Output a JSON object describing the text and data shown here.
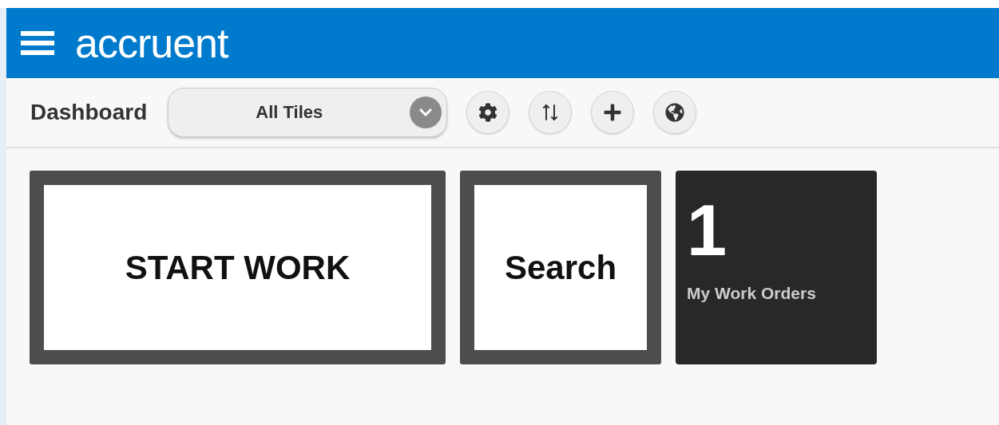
{
  "header": {
    "logo": "accruent"
  },
  "toolbar": {
    "title": "Dashboard",
    "tile_filter": {
      "value": "All Tiles"
    },
    "actions": [
      {
        "kind": "settings"
      },
      {
        "kind": "sort"
      },
      {
        "kind": "add"
      },
      {
        "kind": "globe"
      }
    ]
  },
  "tiles": [
    {
      "kind": "banner",
      "label": "START WORK"
    },
    {
      "kind": "action",
      "label": "Search"
    },
    {
      "kind": "count",
      "count": "1",
      "label": "My Work Orders"
    }
  ]
}
